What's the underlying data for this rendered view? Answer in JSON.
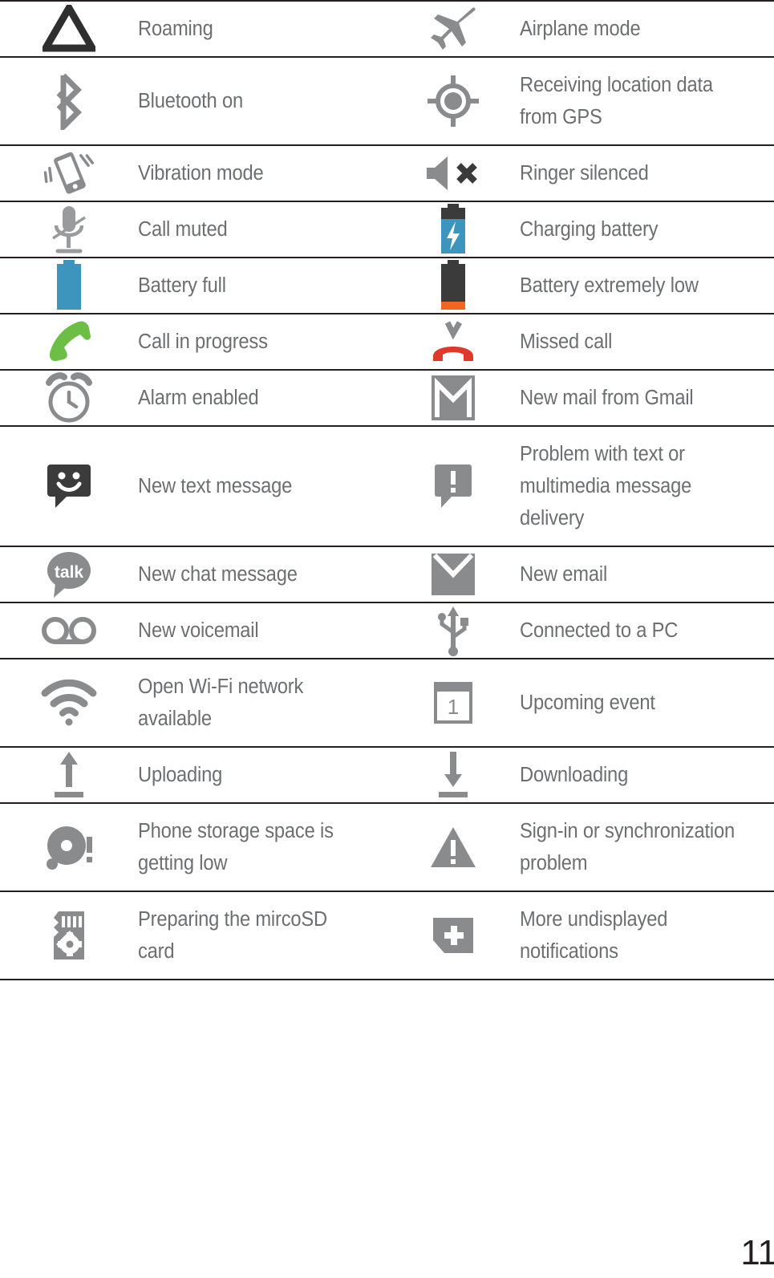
{
  "document": {
    "page_number": "11",
    "text_color": "#6d6e70",
    "rule_color": "#231f20",
    "accent_blue": "#3d95bd",
    "accent_orange": "#f26522",
    "accent_green": "#6cbe45",
    "accent_red": "#e0392b",
    "icon_gray": "#8c8d8f",
    "icon_dark": "#3b3b3b"
  },
  "rows": [
    {
      "left": {
        "icon": "roaming-triangle-icon",
        "label": "Roaming"
      },
      "right": {
        "icon": "airplane-mode-icon",
        "label": "Airplane mode"
      }
    },
    {
      "left": {
        "icon": "bluetooth-on-icon",
        "label": "Bluetooth on"
      },
      "right": {
        "icon": "gps-location-icon",
        "label": "Receiving location data from GPS"
      }
    },
    {
      "left": {
        "icon": "vibration-mode-icon",
        "label": "Vibration mode"
      },
      "right": {
        "icon": "ringer-silenced-icon",
        "label": "Ringer silenced"
      }
    },
    {
      "left": {
        "icon": "call-muted-microphone-icon",
        "label": "Call muted"
      },
      "right": {
        "icon": "charging-battery-icon",
        "label": "Charging battery"
      }
    },
    {
      "left": {
        "icon": "battery-full-icon",
        "label": "Battery full"
      },
      "right": {
        "icon": "battery-extremely-low-icon",
        "label": "Battery extremely low"
      }
    },
    {
      "left": {
        "icon": "call-in-progress-icon",
        "label": "Call in progress"
      },
      "right": {
        "icon": "missed-call-icon",
        "label": "Missed call"
      }
    },
    {
      "left": {
        "icon": "alarm-enabled-icon",
        "label": "Alarm enabled"
      },
      "right": {
        "icon": "gmail-new-mail-icon",
        "label": "New mail from Gmail"
      }
    },
    {
      "left": {
        "icon": "new-text-message-icon",
        "label": "New text message"
      },
      "right": {
        "icon": "message-delivery-problem-icon",
        "label": "Problem with text or multimedia message delivery"
      }
    },
    {
      "left": {
        "icon": "new-chat-message-talk-icon",
        "label": "New chat message"
      },
      "right": {
        "icon": "new-email-envelope-icon",
        "label": "New email"
      }
    },
    {
      "left": {
        "icon": "new-voicemail-icon",
        "label": "New voicemail"
      },
      "right": {
        "icon": "usb-connected-icon",
        "label": "Connected to a PC"
      }
    },
    {
      "left": {
        "icon": "open-wifi-network-icon",
        "label": "Open Wi-Fi network available"
      },
      "right": {
        "icon": "upcoming-event-calendar-icon",
        "label": "Upcoming event"
      }
    },
    {
      "left": {
        "icon": "uploading-icon",
        "label": "Uploading"
      },
      "right": {
        "icon": "downloading-icon",
        "label": "Downloading"
      }
    },
    {
      "left": {
        "icon": "phone-storage-low-icon",
        "label": "Phone storage space is getting low"
      },
      "right": {
        "icon": "sync-problem-warning-icon",
        "label": "Sign-in or synchronization problem"
      }
    },
    {
      "left": {
        "icon": "microsd-preparing-icon",
        "label": "Preparing the mircoSD card"
      },
      "right": {
        "icon": "more-notifications-icon",
        "label": "More undisplayed notifications"
      }
    }
  ]
}
